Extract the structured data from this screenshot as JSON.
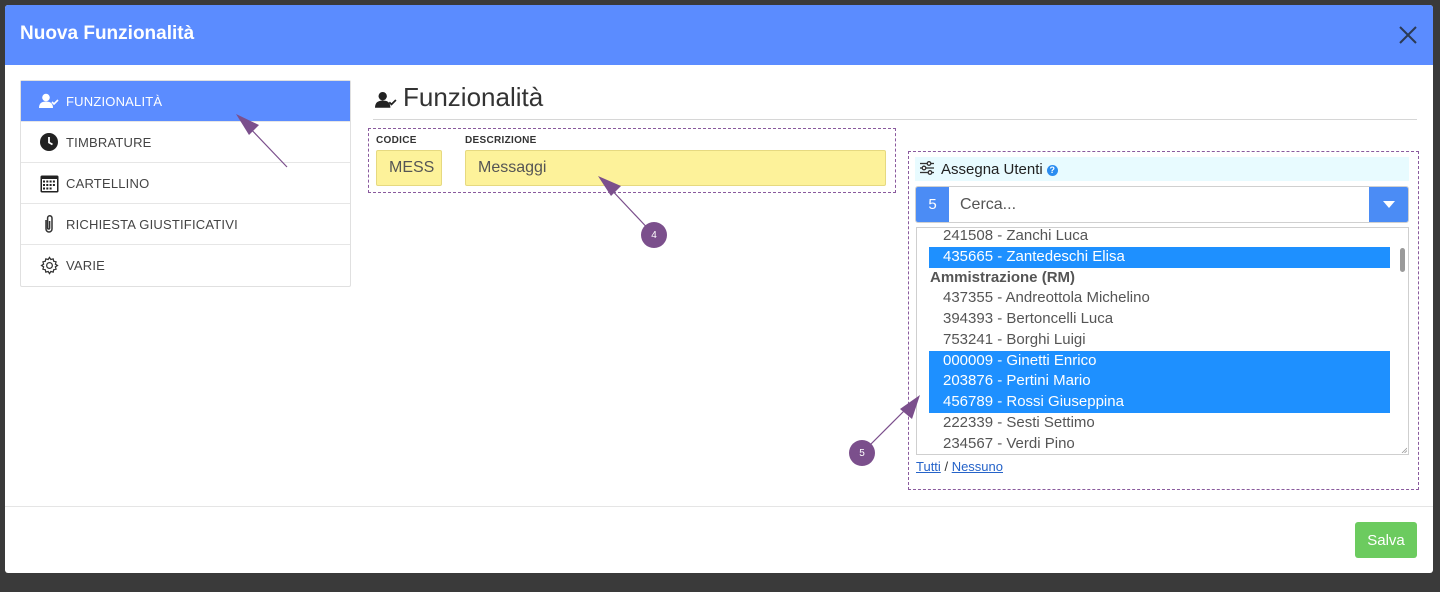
{
  "modal": {
    "title": "Nuova Funzionalità",
    "save_label": "Salva"
  },
  "sidebar": {
    "items": [
      {
        "label": "FUNZIONALITÀ",
        "icon": "user-check-icon",
        "active": true
      },
      {
        "label": "TIMBRATURE",
        "icon": "clock-icon",
        "active": false
      },
      {
        "label": "CARTELLINO",
        "icon": "calendar-icon",
        "active": false
      },
      {
        "label": "RICHIESTA GIUSTIFICATIVI",
        "icon": "paperclip-icon",
        "active": false
      },
      {
        "label": "VARIE",
        "icon": "gear-icon",
        "active": false
      }
    ]
  },
  "main": {
    "title": "Funzionalità",
    "code_label": "CODICE",
    "code_value": "MESS",
    "desc_label": "DESCRIZIONE",
    "desc_value": "Messaggi"
  },
  "assign": {
    "title": "Assegna Utenti",
    "info": "?",
    "selected_count": "5",
    "search_placeholder": "Cerca...",
    "options": [
      {
        "text": "241508 - Zanchi Luca",
        "selected": false
      },
      {
        "text": "435665 - Zantedeschi Elisa",
        "selected": true
      }
    ],
    "group": "Ammistrazione (RM)",
    "group_options": [
      {
        "text": "437355 - Andreottola Michelino",
        "selected": false
      },
      {
        "text": "394393 - Bertoncelli Luca",
        "selected": false
      },
      {
        "text": "753241 - Borghi Luigi",
        "selected": false
      },
      {
        "text": "000009 - Ginetti Enrico",
        "selected": true
      },
      {
        "text": "203876 - Pertini Mario",
        "selected": true
      },
      {
        "text": "456789 - Rossi Giuseppina",
        "selected": true
      },
      {
        "text": "222339 - Sesti Settimo",
        "selected": false
      },
      {
        "text": "234567 - Verdi Pino",
        "selected": false
      }
    ],
    "link_all": "Tutti",
    "link_separator": "/",
    "link_none": "Nessuno"
  },
  "annotations": {
    "marker_4": "4",
    "marker_5": "5"
  },
  "colors": {
    "header": "#5b8cff",
    "accent": "#1e90ff",
    "field_yellow": "#fdf29a",
    "save_green": "#6ccb5f",
    "annotation": "#7b4f8c"
  }
}
